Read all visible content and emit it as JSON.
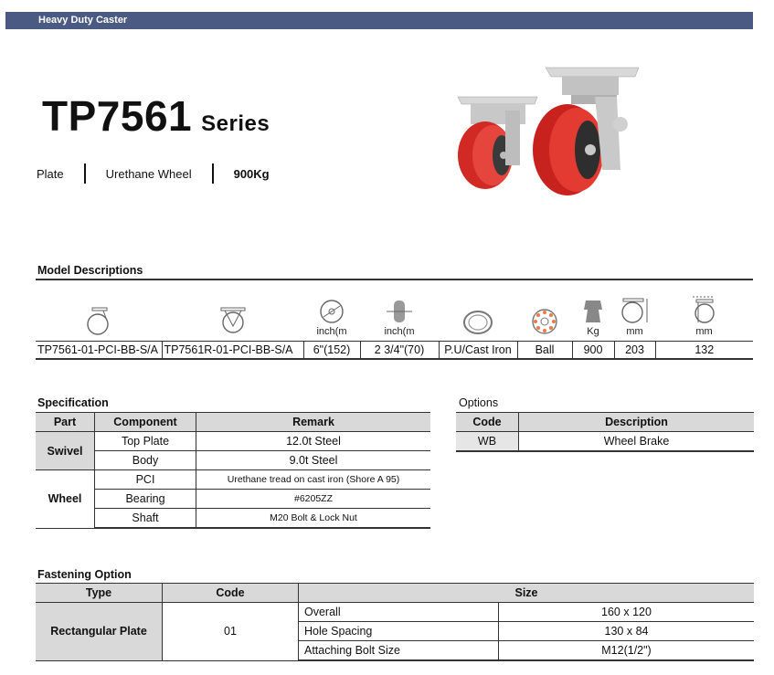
{
  "header": {
    "bar_label": "Heavy Duty Caster"
  },
  "product": {
    "model": "TP7561",
    "series": "Series",
    "attrs": [
      "Plate",
      "Urethane Wheel",
      "900Kg"
    ]
  },
  "model_section": {
    "title": "Model Descriptions",
    "icon_units": [
      "",
      "",
      "inch(m",
      "inch(m",
      "",
      "",
      "Kg",
      "mm",
      "mm"
    ],
    "icons": [
      "swivel-caster-icon",
      "rigid-caster-icon",
      "wheel-diameter-icon",
      "wheel-width-icon",
      "wheel-material-icon",
      "bearing-icon",
      "load-capacity-icon",
      "overall-height-icon",
      "swivel-radius-icon"
    ],
    "row": [
      "TP7561-01-PCI-BB-S/A",
      "TP7561R-01-PCI-BB-S/A",
      "6\"(152)",
      "2 3/4\"(70)",
      "P.U/Cast Iron",
      "Ball",
      "900",
      "203",
      "132"
    ]
  },
  "specification": {
    "title": "Specification",
    "headers": [
      "Part",
      "Component",
      "Remark"
    ],
    "groups": [
      {
        "part": "Swivel",
        "rows": [
          {
            "component": "Top Plate",
            "remark": "12.0t Steel"
          },
          {
            "component": "Body",
            "remark": "9.0t Steel"
          }
        ]
      },
      {
        "part": "Wheel",
        "rows": [
          {
            "component": "PCI",
            "remark": "Urethane tread on cast iron (Shore A 95)"
          },
          {
            "component": "Bearing",
            "remark": "#6205ZZ"
          },
          {
            "component": "Shaft",
            "remark": "M20 Bolt & Lock Nut"
          }
        ]
      }
    ]
  },
  "options": {
    "title": "Options",
    "headers": [
      "Code",
      "Description"
    ],
    "rows": [
      {
        "code": "WB",
        "description": "Wheel Brake"
      }
    ]
  },
  "fastening": {
    "title": "Fastening Option",
    "headers": [
      "Type",
      "Code",
      "Size"
    ],
    "type": "Rectangular Plate",
    "code": "01",
    "rows": [
      {
        "label": "Overall",
        "value": "160 x 120"
      },
      {
        "label": "Hole Spacing",
        "value": "130 x 84"
      },
      {
        "label": "Attaching Bolt Size",
        "value": "M12(1/2\")"
      }
    ]
  },
  "colors": {
    "header_bar": "#4a5a82",
    "wheel_red": "#e0322c",
    "table_fill": "#d9d9d9"
  }
}
